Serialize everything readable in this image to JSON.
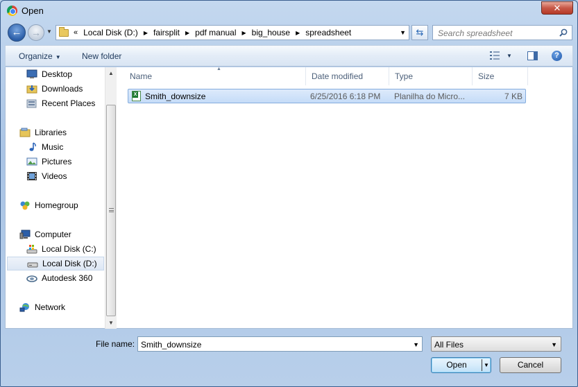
{
  "window": {
    "title": "Open",
    "close_label": "✕"
  },
  "address": {
    "lead": "«",
    "crumbs": [
      "Local Disk (D:)",
      "fairsplit",
      "pdf manual",
      "big_house",
      "spreadsheet"
    ]
  },
  "search": {
    "placeholder": "Search spreadsheet"
  },
  "toolbar": {
    "organize": "Organize",
    "new_folder": "New folder"
  },
  "nav": {
    "desktop": "Desktop",
    "downloads": "Downloads",
    "recent_places": "Recent Places",
    "libraries": "Libraries",
    "music": "Music",
    "pictures": "Pictures",
    "videos": "Videos",
    "homegroup": "Homegroup",
    "computer": "Computer",
    "local_c": "Local Disk (C:)",
    "local_d": "Local Disk (D:)",
    "autodesk": "Autodesk 360",
    "network": "Network"
  },
  "columns": {
    "name": "Name",
    "date": "Date modified",
    "type": "Type",
    "size": "Size"
  },
  "files": [
    {
      "name": "Smith_downsize",
      "date": "6/25/2016 6:18 PM",
      "type": "Planilha do Micro...",
      "size": "7 KB"
    }
  ],
  "footer": {
    "file_name_label": "File name:",
    "file_name_value": "Smith_downsize",
    "file_type": "All Files",
    "open_label": "Open",
    "cancel_label": "Cancel"
  }
}
